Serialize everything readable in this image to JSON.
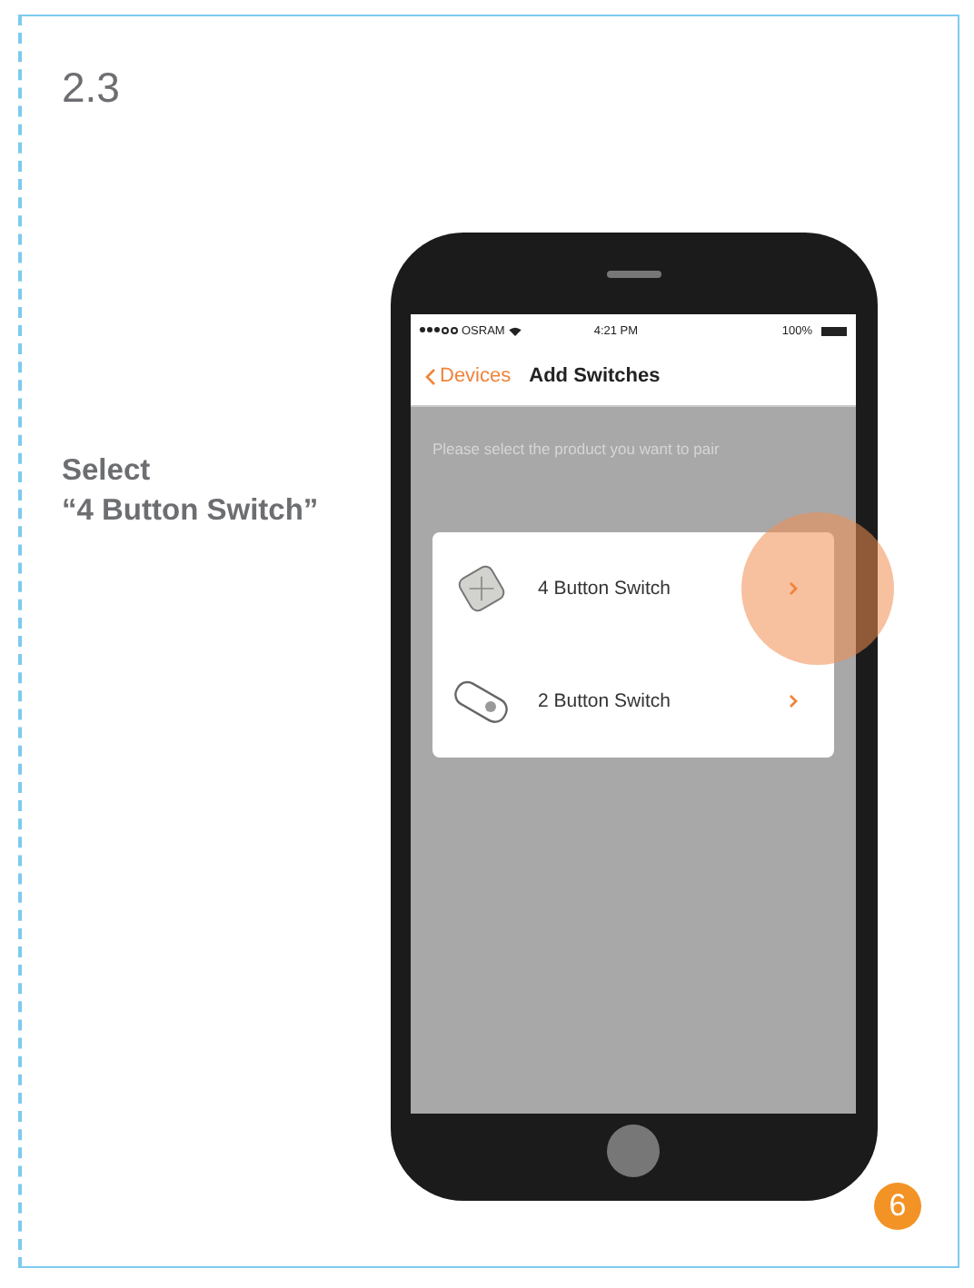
{
  "section": "2.3",
  "instruction": "Select\n“4 Button Switch”",
  "phone": {
    "status_bar": {
      "carrier": "OSRAM",
      "time": "4:21 PM",
      "battery": "100%"
    },
    "nav": {
      "back": "Devices",
      "title": "Add Switches"
    },
    "prompt": "Please select the product you want to pair",
    "products": [
      {
        "label": "4 Button Switch",
        "kind": "four-button",
        "highlighted": true
      },
      {
        "label": "2 Button Switch",
        "kind": "two-button",
        "highlighted": false
      }
    ]
  },
  "step_badge": "6"
}
